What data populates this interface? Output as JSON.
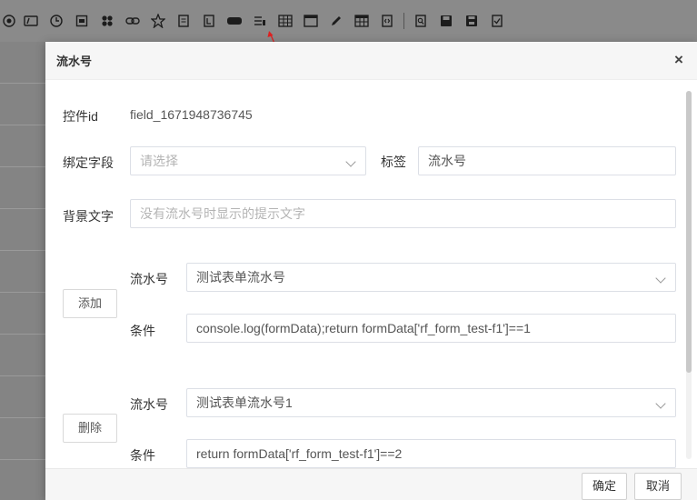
{
  "toolbar": {
    "icons": [
      "eye-icon",
      "tag-icon",
      "clock-icon",
      "calendar-icon",
      "flower-icon",
      "link-icon",
      "star-icon",
      "document-icon",
      "bracket-icon",
      "pill-icon",
      "serial-number-icon",
      "grid-icon",
      "window-icon",
      "pen-icon",
      "table-icon",
      "file-code-icon",
      "preview-icon",
      "save-icon",
      "save-as-icon",
      "checkbox-icon"
    ]
  },
  "modal": {
    "title": "流水号",
    "close": "×",
    "control_id_label": "控件id",
    "control_id_value": "field_1671948736745",
    "bind_field_label": "绑定字段",
    "bind_field_placeholder": "请选择",
    "tag_label": "标签",
    "tag_value": "流水号",
    "bg_text_label": "背景文字",
    "bg_text_placeholder": "没有流水号时显示的提示文字",
    "rules": [
      {
        "button": "添加",
        "serial_label": "流水号",
        "serial_value": "测试表单流水号",
        "condition_label": "条件",
        "condition_value": "console.log(formData);return formData['rf_form_test-f1']==1"
      },
      {
        "button": "删除",
        "serial_label": "流水号",
        "serial_value": "测试表单流水号1",
        "condition_label": "条件",
        "condition_value": "return formData['rf_form_test-f1']==2"
      }
    ],
    "ok_button": "确定",
    "cancel_button": "取消"
  }
}
